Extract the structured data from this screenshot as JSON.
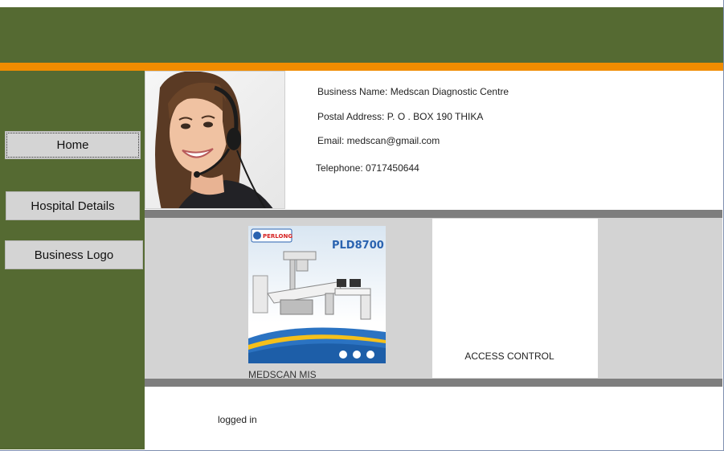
{
  "sidebar": {
    "home_label": "Home",
    "hospital_details_label": "Hospital Details",
    "business_logo_label": "Business Logo"
  },
  "business": {
    "name_line": "Business Name: Medscan Diagnostic Centre",
    "postal_line": "Postal Address:  P. O . BOX 190 THIKA",
    "email_line": "Email:  medscan@gmail.com",
    "phone_line": "Telephone: 0717450644"
  },
  "product": {
    "brand_text": "PERLONG",
    "model_text": "PLD8700",
    "caption": "MEDSCAN MIS"
  },
  "access": {
    "label": "ACCESS CONTROL"
  },
  "status": {
    "text": "logged in"
  },
  "colors": {
    "header": "#556a32",
    "accent": "#f08c00",
    "panel_gray": "#d3d3d3",
    "divider": "#7e7e7e"
  }
}
